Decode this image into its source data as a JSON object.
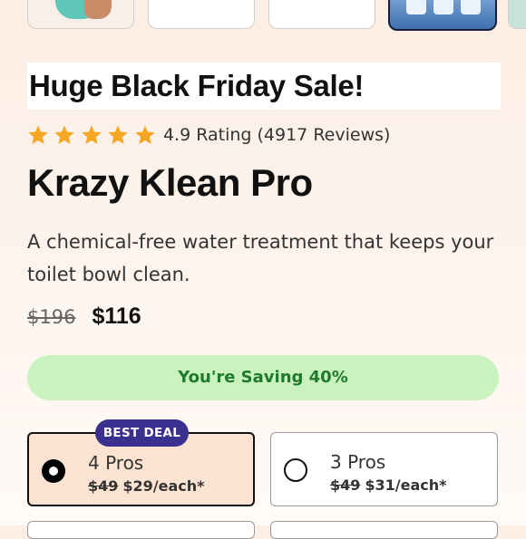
{
  "gallery": {
    "thumbnails": [
      "thumb-1",
      "thumb-2",
      "thumb-3",
      "thumb-4",
      "thumb-5"
    ],
    "selected_index": 3
  },
  "promo": {
    "banner": "Huge Black Friday Sale!"
  },
  "rating": {
    "stars": 5,
    "text": "4.9 Rating (4917 Reviews)",
    "star_color": "#f5a623"
  },
  "product": {
    "title": "Krazy Klean Pro",
    "description": "A chemical-free water treatment that keeps your toilet bowl clean."
  },
  "pricing": {
    "original": "$196",
    "current": "$116",
    "saving_text": "You're Saving 40%",
    "saving_bg": "#c9f2bf",
    "saving_fg": "#1e7a2a"
  },
  "bundle": {
    "badge": "BEST DEAL",
    "badge_color": "#3b2f8f",
    "options": [
      {
        "name": "4 Pros",
        "old": "$49",
        "price": "$29/each*",
        "selected": true
      },
      {
        "name": "3 Pros",
        "old": "$49",
        "price": "$31/each*",
        "selected": false
      }
    ]
  }
}
